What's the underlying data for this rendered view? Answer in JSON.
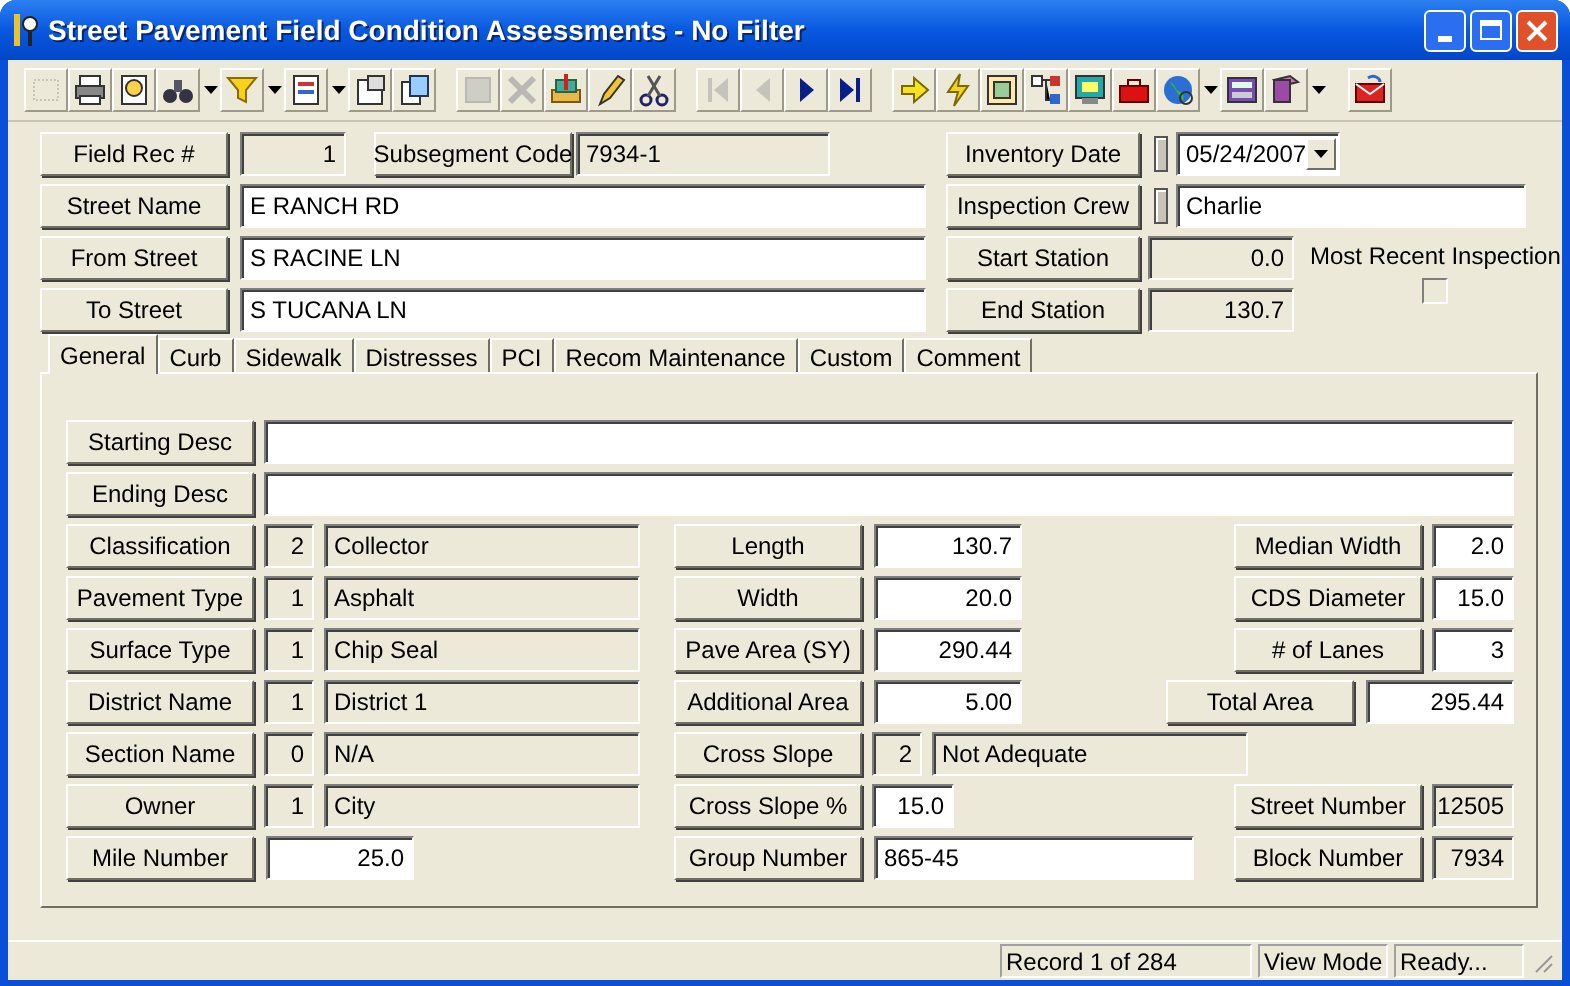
{
  "window": {
    "title": "Street Pavement Field Condition Assessments - No Filter"
  },
  "record": {
    "field_rec": {
      "label": "Field Rec #",
      "value": "1",
      "editable": false
    },
    "subsegment": {
      "label": "Subsegment Code",
      "value": "7934-1",
      "editable": false
    },
    "streets": [
      {
        "label": "Street Name",
        "value": "E RANCH RD",
        "editable": true
      },
      {
        "label": "From Street",
        "value": "S RACINE LN",
        "editable": true
      },
      {
        "label": "To Street",
        "value": "S TUCANA LN",
        "editable": true
      }
    ]
  },
  "inspection": {
    "inventory_date": {
      "label": "Inventory Date",
      "value": "05/24/2007"
    },
    "inspection_crew": {
      "label": "Inspection Crew",
      "value": "Charlie"
    },
    "start_station": {
      "label": "Start Station",
      "value": "0.0",
      "editable": false
    },
    "end_station": {
      "label": "End Station",
      "value": "130.7",
      "editable": false
    },
    "most_recent": {
      "label": "Most Recent Inspection",
      "checked": false
    }
  },
  "tabs": [
    {
      "label": "General",
      "selected": true
    },
    {
      "label": "Curb",
      "selected": false
    },
    {
      "label": "Sidewalk",
      "selected": false
    },
    {
      "label": "Distresses",
      "selected": false
    },
    {
      "label": "PCI",
      "selected": false
    },
    {
      "label": "Recom Maintenance",
      "selected": false
    },
    {
      "label": "Custom",
      "selected": false
    },
    {
      "label": "Comment",
      "selected": false
    }
  ],
  "general": {
    "descriptions": [
      {
        "label": "Starting Desc"
      },
      {
        "label": "Ending Desc"
      }
    ],
    "left": [
      {
        "kind": "coded",
        "label": "Classification",
        "code": "2",
        "value": "Collector"
      },
      {
        "kind": "coded",
        "label": "Pavement Type",
        "code": "1",
        "value": "Asphalt"
      },
      {
        "kind": "coded",
        "label": "Surface Type",
        "code": "1",
        "value": "Chip Seal"
      },
      {
        "kind": "coded",
        "label": "District Name",
        "code": "1",
        "value": "District 1"
      },
      {
        "kind": "coded",
        "label": "Section Name",
        "code": "0",
        "value": "N/A"
      },
      {
        "kind": "coded",
        "label": "Owner",
        "code": "1",
        "value": "City"
      },
      {
        "kind": "number",
        "label": "Mile Number",
        "value": "25.0",
        "editable": true
      }
    ],
    "middle": [
      {
        "kind": "number",
        "label": "Length",
        "value": "130.7",
        "editable": true
      },
      {
        "kind": "number",
        "label": "Width",
        "value": "20.0",
        "editable": true
      },
      {
        "kind": "number",
        "label": "Pave Area (SY)",
        "value": "290.44",
        "editable": true
      },
      {
        "kind": "number",
        "label": "Additional Area",
        "value": "5.00",
        "editable": true
      },
      {
        "kind": "coded",
        "label": "Cross Slope",
        "code": "2",
        "value": "Not Adequate"
      },
      {
        "kind": "small_number",
        "label": "Cross Slope %",
        "value": "15.0",
        "editable": true
      },
      {
        "kind": "text",
        "label": "Group Number",
        "value": "865-45",
        "editable": true
      }
    ],
    "right_top": [
      {
        "kind": "small_number",
        "label": "Median Width",
        "value": "2.0",
        "editable": true
      },
      {
        "kind": "small_number",
        "label": "CDS Diameter",
        "value": "15.0",
        "editable": true
      },
      {
        "kind": "small_number",
        "label": "# of Lanes",
        "value": "3",
        "editable": true
      },
      {
        "kind": "number",
        "label": "Total Area",
        "value": "295.44",
        "editable": true
      }
    ],
    "right_bottom": [
      {
        "kind": "small_number",
        "label": "Street Number",
        "value": "12505",
        "editable": false
      },
      {
        "kind": "small_number",
        "label": "Block Number",
        "value": "7934",
        "editable": false
      }
    ]
  },
  "status_bar": [
    "Record 1 of 284",
    "View Mode",
    "Ready..."
  ]
}
